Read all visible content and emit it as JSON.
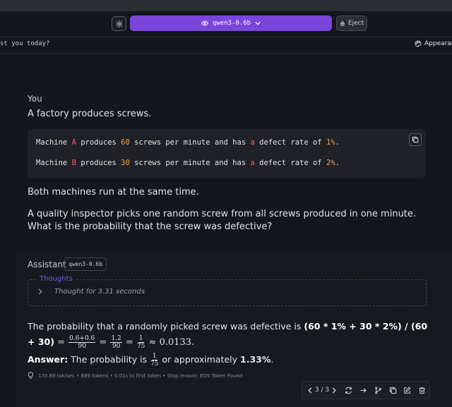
{
  "header": {
    "model_name": "qwen3-0.6b",
    "eject_label": "Eject"
  },
  "subbar": {
    "chat_title": "st you today?",
    "appearance_label": "Appearance"
  },
  "user_message": {
    "role_label": "You",
    "line1": "A factory produces screws.",
    "code": {
      "l1_a": "Machine ",
      "l1_b": "A",
      "l1_c": " produces ",
      "l1_d": "60",
      "l1_e": " screws per minute and has ",
      "l1_f": "a",
      "l1_g": " defect rate of ",
      "l1_h": "1%",
      "l1_i": ".",
      "l2_a": "Machine ",
      "l2_b": "B",
      "l2_c": " produces ",
      "l2_d": "30",
      "l2_e": " screws per minute and has ",
      "l2_f": "a",
      "l2_g": " defect rate of ",
      "l2_h": "2%",
      "l2_i": "."
    },
    "para1": "Both machines run at the same time.",
    "para2_line1": "A quality inspector picks one random screw from all screws produced in one minute.",
    "para2_line2": "What is the probability that the screw was defective?"
  },
  "assistant": {
    "role_label": "Assistant",
    "model_badge": "qwen3-0.6b",
    "thoughts_legend": "Thoughts",
    "thoughts_summary": "Thought for 3.31 seconds",
    "answer_lead": "The probability that a randomly picked screw was defective is ",
    "answer_expr": "(60 * 1% + 30 * 2%) / (60 + 30)",
    "frac1_num": "0.6+0.6",
    "frac1_den": "90",
    "frac2_num": "1.2",
    "frac2_den": "90",
    "frac3_num": "1",
    "frac3_den": "75",
    "approx_value": "0.0133",
    "answer_label": "Answer:",
    "answer_text": " The probability is ",
    "answer_mid": " or approximately ",
    "answer_percent": "1.33%",
    "answer_end": ".",
    "stats": "170.89 tok/sec • 689 tokens • 0.01s to first token • Stop reason: EOS Token Found"
  },
  "actions": {
    "pager": "3 / 3"
  },
  "colors": {
    "accent": "#7b45dc",
    "keyword": "#ff5c6a",
    "number": "#f0a050"
  }
}
